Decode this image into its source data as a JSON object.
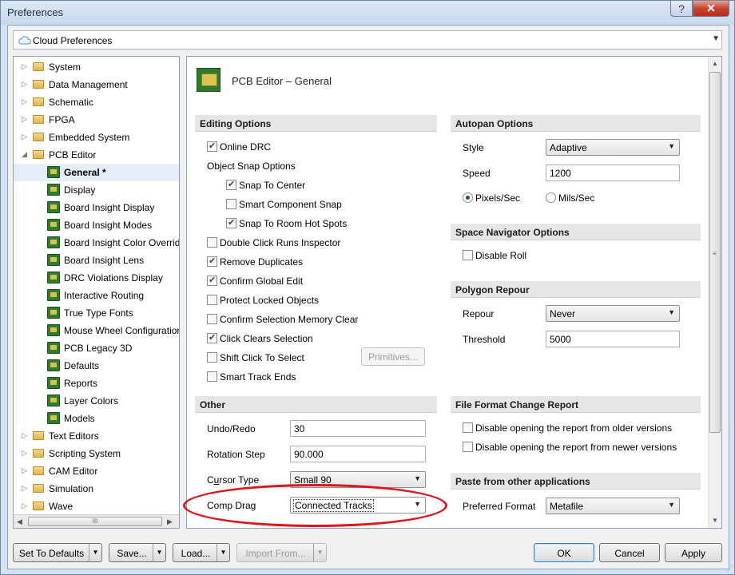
{
  "window": {
    "title": "Preferences",
    "help_glyph": "?",
    "close_glyph": "✕"
  },
  "cloud": {
    "label": "Cloud Preferences",
    "icon": "cloud-icon"
  },
  "tree": {
    "items": [
      {
        "label": "System",
        "type": "folder",
        "expander": "▷"
      },
      {
        "label": "Data Management",
        "type": "folder",
        "expander": "▷"
      },
      {
        "label": "Schematic",
        "type": "folder",
        "expander": "▷"
      },
      {
        "label": "FPGA",
        "type": "folder",
        "expander": "▷"
      },
      {
        "label": "Embedded System",
        "type": "folder",
        "expander": "▷"
      },
      {
        "label": "PCB Editor",
        "type": "folder",
        "expander": "◢"
      },
      {
        "label": "General *",
        "type": "pcb",
        "selected": true
      },
      {
        "label": "Display",
        "type": "pcb"
      },
      {
        "label": "Board Insight Display",
        "type": "pcb"
      },
      {
        "label": "Board Insight Modes",
        "type": "pcb"
      },
      {
        "label": "Board Insight Color Overrid",
        "type": "pcb"
      },
      {
        "label": "Board Insight Lens",
        "type": "pcb"
      },
      {
        "label": "DRC Violations Display",
        "type": "pcb"
      },
      {
        "label": "Interactive Routing",
        "type": "pcb"
      },
      {
        "label": "True Type Fonts",
        "type": "pcb"
      },
      {
        "label": "Mouse Wheel Configuration",
        "type": "pcb"
      },
      {
        "label": "PCB Legacy 3D",
        "type": "pcb"
      },
      {
        "label": "Defaults",
        "type": "pcb"
      },
      {
        "label": "Reports",
        "type": "pcb"
      },
      {
        "label": "Layer Colors",
        "type": "pcb"
      },
      {
        "label": "Models",
        "type": "pcb"
      },
      {
        "label": "Text Editors",
        "type": "folder",
        "expander": "▷"
      },
      {
        "label": "Scripting System",
        "type": "folder",
        "expander": "▷"
      },
      {
        "label": "CAM Editor",
        "type": "folder",
        "expander": "▷"
      },
      {
        "label": "Simulation",
        "type": "folder",
        "expander": "▷"
      },
      {
        "label": "Wave",
        "type": "folder",
        "expander": "▷"
      }
    ],
    "scroll_grip": "III"
  },
  "page": {
    "title": "PCB Editor – General"
  },
  "editing": {
    "header": "Editing Options",
    "online_drc": {
      "label": "Online DRC",
      "checked": true
    },
    "object_snap_label": "Object Snap Options",
    "snap_to_center": {
      "label": "Snap To Center",
      "checked": true
    },
    "smart_component_snap": {
      "label": "Smart Component Snap",
      "checked": false
    },
    "snap_to_room_hot_spots": {
      "label": "Snap To Room Hot Spots",
      "checked": true
    },
    "double_click_runs_inspector": {
      "label": "Double Click Runs Inspector",
      "checked": false
    },
    "remove_duplicates": {
      "label": "Remove Duplicates",
      "checked": true
    },
    "confirm_global_edit": {
      "label": "Confirm Global Edit",
      "checked": true
    },
    "protect_locked_objects": {
      "label": "Protect Locked Objects",
      "checked": false
    },
    "confirm_selection_memory_clear": {
      "label": "Confirm Selection Memory Clear",
      "checked": false
    },
    "click_clears_selection": {
      "label": "Click Clears Selection",
      "checked": true
    },
    "shift_click_to_select": {
      "label": "Shift Click To Select",
      "checked": false
    },
    "smart_track_ends": {
      "label": "Smart Track Ends",
      "checked": false
    },
    "primitives_button": "Primitives..."
  },
  "other": {
    "header": "Other",
    "undo_redo": {
      "label": "Undo/Redo",
      "value": "30"
    },
    "rotation_step": {
      "label": "Rotation Step",
      "value": "90.000"
    },
    "cursor_type": {
      "label_prefix": "C",
      "label_underlined": "u",
      "label_suffix": "rsor Type",
      "value": "Small 90"
    },
    "comp_drag": {
      "label": "Comp Drag",
      "value": "Connected Tracks"
    }
  },
  "autopan": {
    "header": "Autopan Options",
    "style": {
      "label": "Style",
      "value": "Adaptive"
    },
    "speed": {
      "label": "Speed",
      "value": "1200"
    },
    "pixels_sec": {
      "label": "Pixels/Sec",
      "selected": true
    },
    "mils_sec": {
      "label": "Mils/Sec",
      "selected": false
    }
  },
  "space_navigator": {
    "header": "Space Navigator Options",
    "disable_roll": {
      "label": "Disable Roll",
      "checked": false
    }
  },
  "polygon": {
    "header": "Polygon Repour",
    "repour": {
      "label": "Repour",
      "value": "Never"
    },
    "threshold": {
      "label": "Threshold",
      "value": "5000"
    }
  },
  "file_format": {
    "header": "File Format Change Report",
    "older": {
      "label": "Disable opening the report from older versions",
      "checked": false
    },
    "newer": {
      "label": "Disable opening the report from newer versions",
      "checked": false
    }
  },
  "paste": {
    "header": "Paste from other applications",
    "preferred_format": {
      "label": "Preferred Format",
      "value": "Metafile"
    }
  },
  "footer": {
    "set_to_defaults": "Set To Defaults",
    "save": "Save...",
    "load": "Load...",
    "import_from": "Import From...",
    "ok": "OK",
    "cancel": "Cancel",
    "apply": "Apply"
  },
  "glyphs": {
    "dropdown_arrow": "▼",
    "scroll_up": "▲",
    "scroll_down": "▼",
    "scroll_left": "◀",
    "scroll_right": "▶",
    "grip": "≡",
    "resize": "⋰"
  },
  "colors": {
    "highlight_ellipse": "#e0141c",
    "selection_bg": "#e5eef8"
  }
}
